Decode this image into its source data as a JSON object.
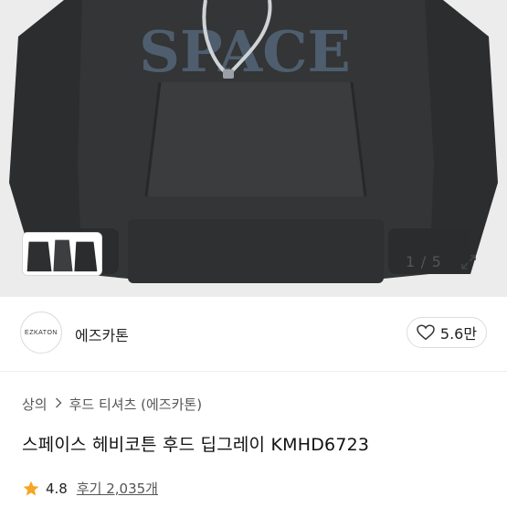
{
  "gallery": {
    "print_text": "SPACE",
    "page_current": "1",
    "page_separator": "/",
    "page_total": "5",
    "expand_icon": "expand-arrows-icon"
  },
  "brand": {
    "logo_text": "EZKATON",
    "name": "에즈카톤",
    "like_icon": "heart-icon",
    "like_count": "5.6만"
  },
  "breadcrumb": {
    "items": [
      "상의",
      "후드 티셔츠 (에즈카톤)"
    ],
    "separator_icon": "chevron-right-icon"
  },
  "product": {
    "title": "스페이스 헤비코튼 후드 딥그레이 KMHD6723"
  },
  "rating": {
    "icon": "star-icon",
    "star_color": "#f5a623",
    "score": "4.8",
    "reviews_label": "후기 2,035개"
  }
}
